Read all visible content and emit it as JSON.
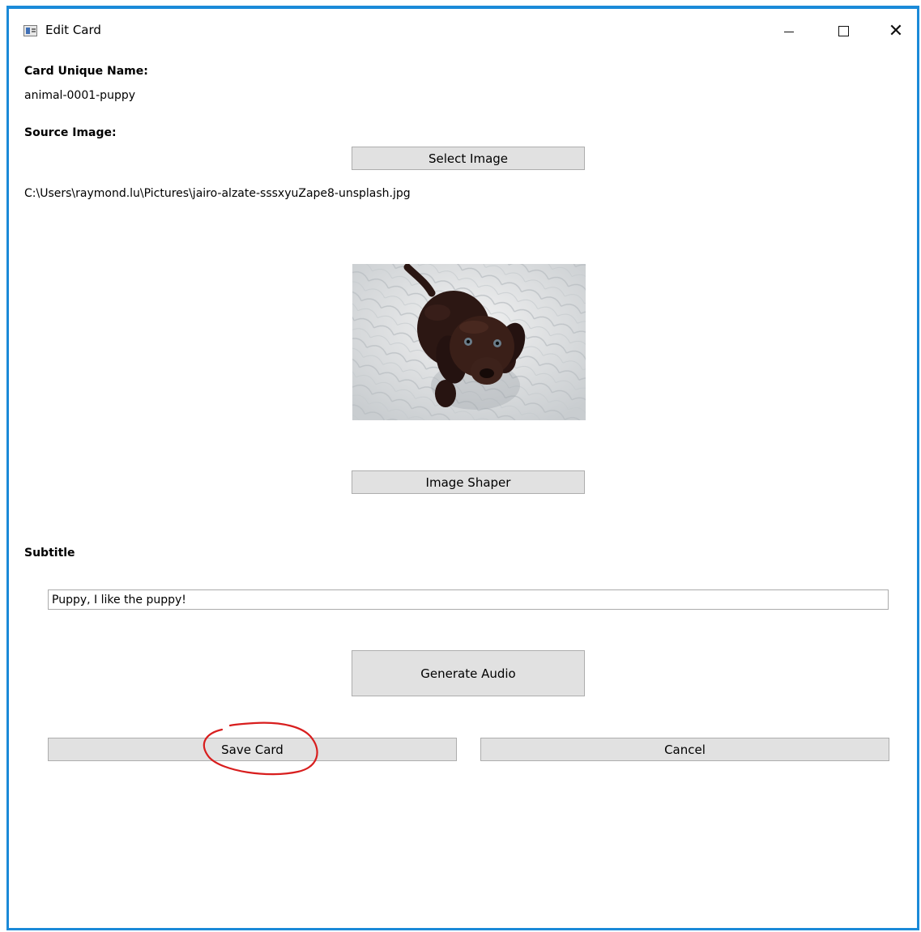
{
  "window": {
    "title": "Edit Card"
  },
  "form": {
    "card_name_label": "Card Unique Name:",
    "card_name_value": "animal-0001-puppy",
    "source_image_label": "Source Image:",
    "select_image_button": "Select Image",
    "image_path": "C:\\Users\\raymond.lu\\Pictures\\jairo-alzate-sssxyuZape8-unsplash.jpg",
    "image_shaper_button": "Image Shaper",
    "subtitle_label": "Subtitle",
    "subtitle_value": "Puppy, I like the puppy!",
    "generate_audio_button": "Generate Audio",
    "save_button": "Save Card",
    "cancel_button": "Cancel"
  },
  "colors": {
    "window_border": "#1b8ad8",
    "button_bg": "#e1e1e1",
    "annotation": "#d81e1e"
  }
}
